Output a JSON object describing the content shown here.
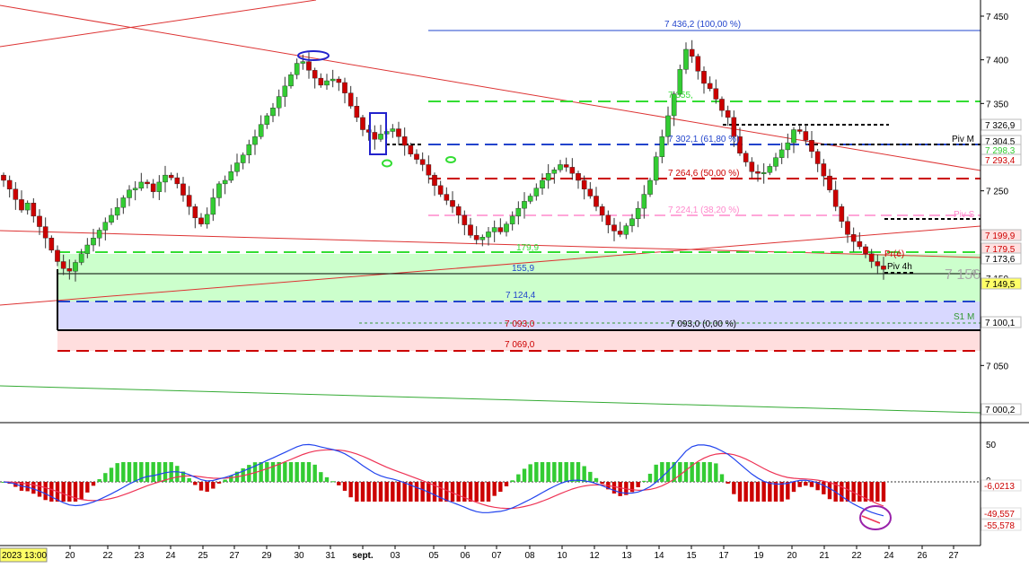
{
  "chart_data": [
    {
      "type": "candlestick",
      "instrument": "",
      "y_axis": {
        "ticks": [
          7450,
          7400,
          7350,
          7300,
          7250,
          7200,
          7150,
          7100,
          7050,
          7000
        ],
        "tick_labels": [
          "7 450",
          "7 400",
          "7 350",
          "7 300",
          "7 250",
          "7 200",
          "7 150",
          "7 100",
          "7 050",
          "7 000"
        ],
        "range": [
          6968,
          7470
        ]
      },
      "x_axis": {
        "first_label": "2023 13:00",
        "labels": [
          "20",
          "22",
          "23",
          "24",
          "25",
          "27",
          "29",
          "30",
          "31",
          "sept.",
          "03",
          "05",
          "06",
          "07",
          "08",
          "10",
          "12",
          "13",
          "14",
          "15",
          "17",
          "19",
          "20",
          "21",
          "22",
          "24",
          "26",
          "27"
        ]
      },
      "close_series": [
        7262,
        7252,
        7240,
        7228,
        7236,
        7221,
        7209,
        7196,
        7182,
        7169,
        7161,
        7158,
        7168,
        7178,
        7188,
        7196,
        7205,
        7214,
        7222,
        7231,
        7242,
        7251,
        7253,
        7260,
        7258,
        7249,
        7260,
        7268,
        7265,
        7258,
        7245,
        7232,
        7219,
        7212,
        7223,
        7242,
        7258,
        7262,
        7272,
        7282,
        7291,
        7303,
        7312,
        7326,
        7336,
        7345,
        7358,
        7370,
        7383,
        7396,
        7398,
        7388,
        7379,
        7371,
        7376,
        7378,
        7374,
        7362,
        7347,
        7334,
        7320,
        7317,
        7309,
        7315,
        7318,
        7321,
        7312,
        7302,
        7292,
        7286,
        7280,
        7268,
        7256,
        7246,
        7239,
        7232,
        7222,
        7211,
        7199,
        7194,
        7197,
        7203,
        7208,
        7203,
        7212,
        7221,
        7230,
        7238,
        7244,
        7253,
        7262,
        7270,
        7274,
        7280,
        7277,
        7270,
        7262,
        7252,
        7244,
        7232,
        7222,
        7211,
        7204,
        7200,
        7210,
        7218,
        7230,
        7246,
        7262,
        7289,
        7312,
        7336,
        7361,
        7389,
        7412,
        7404,
        7387,
        7373,
        7367,
        7355,
        7342,
        7334,
        7312,
        7293,
        7283,
        7272,
        7270,
        7271,
        7278,
        7288,
        7297,
        7305,
        7320,
        7318,
        7308,
        7295,
        7281,
        7267,
        7251,
        7232,
        7215,
        7200,
        7192,
        7186,
        7178,
        7169,
        7164,
        7160
      ]
    },
    {
      "type": "macd",
      "y_axis": {
        "ticks": [
          50,
          0
        ],
        "tick_labels": [
          "50",
          "0"
        ]
      },
      "value_labels": [
        "-6,0213",
        "-49,557",
        "-55,578"
      ]
    }
  ],
  "levels": {
    "fib_100": "7 436,2 (100,00 %)",
    "fib_762": "7 355,",
    "fib_618": "7 302,1 (61,80 %)",
    "fib_500": "7 264,6 (50,00 %)",
    "fib_382": "7 224,1 (38,20 %)",
    "fib_236": "179,9",
    "fib_0": "7 093,0 (0,00 %)",
    "low_1": "155,9",
    "low_2": "7 124,4",
    "red_1": "7 093,0",
    "red_2": "7 069,0",
    "piv_m": "Piv M",
    "piv_s": "Piv S",
    "s1_m": "S1 M",
    "prec": "Pr(é)",
    "piv_4h": "Piv 4h",
    "price_big": "7 156",
    "price_big_suffix": "0",
    "tags": [
      {
        "text": "7 326,9",
        "bg": "#ffffff",
        "fg": "#000000"
      },
      {
        "text": "7 304,5",
        "bg": "#ffffff",
        "fg": "#000000"
      },
      {
        "text": "7 298,3",
        "bg": "#ffffff",
        "fg": "#33cc33"
      },
      {
        "text": "7 293,4",
        "bg": "#ffffff",
        "fg": "#cc0000"
      },
      {
        "text": "7 199,9",
        "bg": "#ffe0e0",
        "fg": "#cc0000"
      },
      {
        "text": "7 179,5",
        "bg": "#ffe0e0",
        "fg": "#cc0000"
      },
      {
        "text": "7 173,6",
        "bg": "#ffffff",
        "fg": "#000000"
      },
      {
        "text": "7 149,5",
        "bg": "#ffff66",
        "fg": "#000000"
      },
      {
        "text": "7 100,1",
        "bg": "#ffffff",
        "fg": "#000000"
      },
      {
        "text": "7 000,2",
        "bg": "#ffffff",
        "fg": "#000000"
      }
    ]
  },
  "colors": {
    "up": "#33cc33",
    "down": "#cc0000",
    "fib_blue": "#2244cc",
    "green_dash": "#33dd33",
    "red_dash": "#cc0000",
    "pink_dash": "#ff88cc",
    "zone_green": "#ccffcc",
    "zone_blue": "#d8d8ff",
    "zone_red": "#ffdede"
  }
}
